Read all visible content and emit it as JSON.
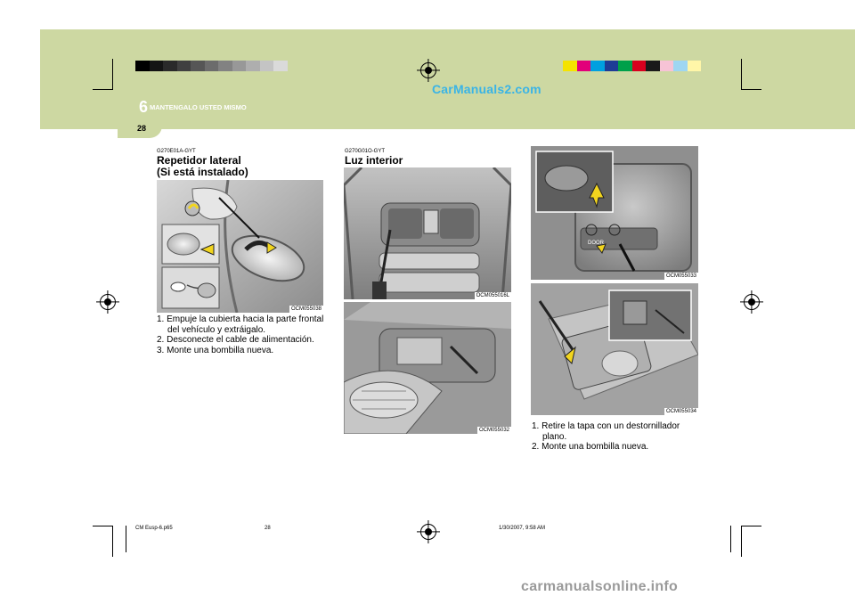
{
  "header": {
    "chapter_number": "6",
    "chapter_title": "MANTENGALO USTED MISMO",
    "page_number": "28",
    "site_link": "CarManuals2.com"
  },
  "sections": {
    "repeater": {
      "code": "G270E01A-GYT",
      "title_line1": "Repetidor lateral",
      "title_line2": "(Si está instalado)",
      "image_caption": "OCM055038",
      "steps": [
        "1. Empuje la cubierta hacia la parte frontal del vehículo y extráigalo.",
        "2. Desconecte el cable de alimentación.",
        "3. Monte una bombilla nueva."
      ]
    },
    "interior": {
      "code": "G270G01O-GYT",
      "title": "Luz interior",
      "image1_caption": "OCM055016L",
      "image2_caption": "OCM055032",
      "image3_caption": "OCM055033",
      "image3_label": "DOOR",
      "image4_caption": "OCM055034",
      "steps": [
        "1. Retire la tapa con un destornillador plano.",
        "2. Monte una bombilla nueva."
      ]
    }
  },
  "footer": {
    "file": "CM Eusp-6.p65",
    "page": "28",
    "timestamp": "1/30/2007, 9:58 AM"
  },
  "watermark": "carmanualsonline.info",
  "colors": {
    "band": "#cdd8a2",
    "link": "#3ab4e6",
    "arrow": "#f2d51e"
  }
}
